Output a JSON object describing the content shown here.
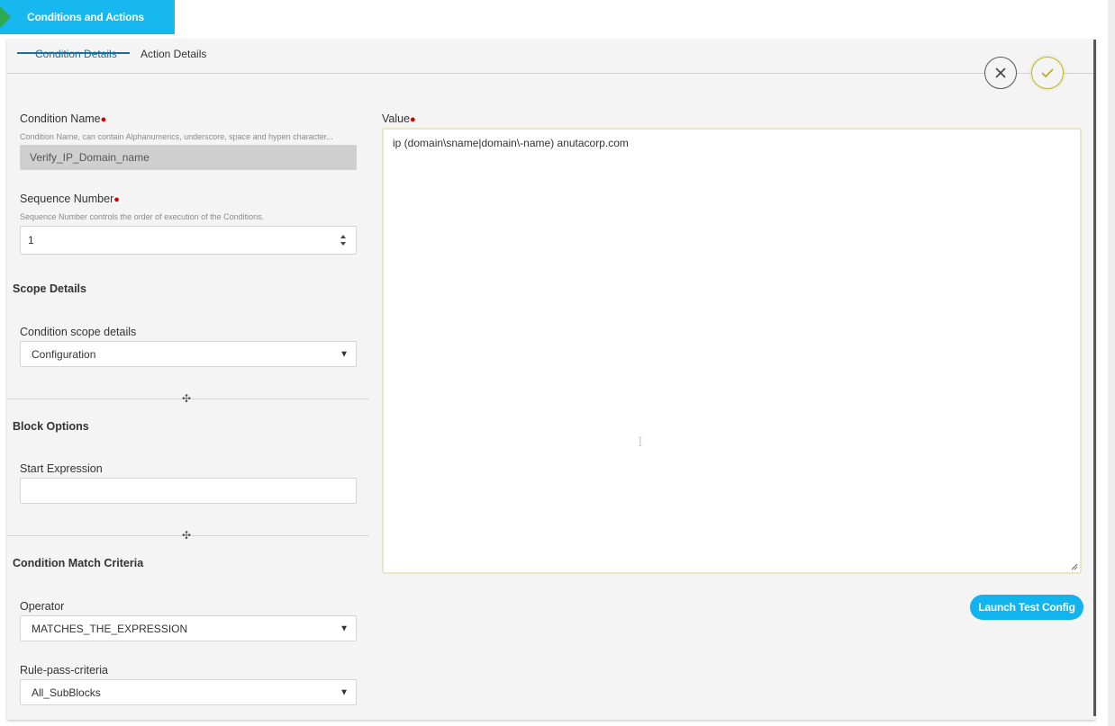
{
  "breadcrumb": {
    "title": "Conditions and Actions"
  },
  "tabs": [
    {
      "label": "Condition Details"
    },
    {
      "label": "Action Details"
    }
  ],
  "condition_name": {
    "label": "Condition Name",
    "hint": "Condition Name, can contain Alphanumerics, underscore, space and hypen character...",
    "value": "Verify_IP_Domain_name"
  },
  "sequence_number": {
    "label": "Sequence Number",
    "hint": "Sequence Number controls the order of execution of the Conditions.",
    "value": "1"
  },
  "scope": {
    "section_title": "Scope Details",
    "label": "Condition scope details",
    "value": "Configuration"
  },
  "block_options": {
    "section_title": "Block Options",
    "start_expression_label": "Start Expression",
    "start_expression_value": ""
  },
  "match_criteria": {
    "section_title": "Condition Match Criteria",
    "operator_label": "Operator",
    "operator_value": "MATCHES_THE_EXPRESSION",
    "rule_label": "Rule-pass-criteria",
    "rule_value": "All_SubBlocks"
  },
  "value_field": {
    "label": "Value",
    "text": "ip (domain\\sname|domain\\-name) anutacorp.com"
  },
  "launch_button": {
    "label": "Launch Test Config"
  },
  "required_marker": "●",
  "colors": {
    "accent": "#17b8f0",
    "tab_active": "#1a6e99",
    "confirm": "#c2b92a",
    "required": "#d10000"
  },
  "icons": {
    "cancel": "close-icon",
    "confirm": "check-icon",
    "stepper": "spinner-arrows-icon",
    "dropdown": "caret-down-icon",
    "divider": "drag-handle-icon"
  }
}
